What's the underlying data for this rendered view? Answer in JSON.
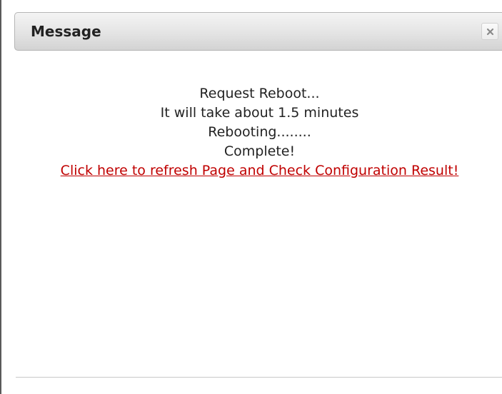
{
  "dialog": {
    "title": "Message",
    "close_icon": "close-icon"
  },
  "message": {
    "lines": [
      "Request Reboot...",
      "It will take about 1.5 minutes",
      "Rebooting........",
      "Complete!"
    ],
    "link_text": "Click here to refresh Page and Check Configuration Result!"
  },
  "colors": {
    "link": "#c00000",
    "text": "#222222",
    "titlebar_top": "#f4f4f4",
    "titlebar_bottom": "#d3d3d3"
  }
}
